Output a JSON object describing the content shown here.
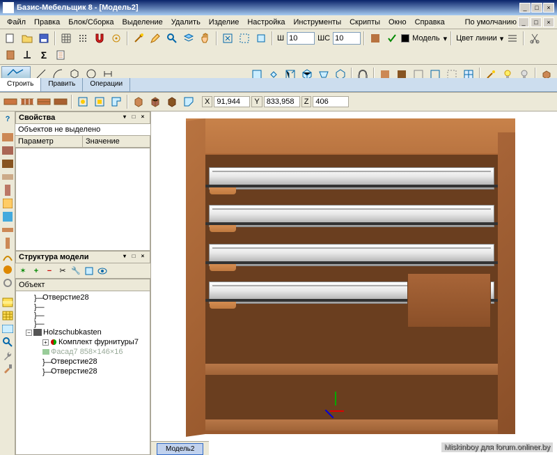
{
  "title": "Базис-Мебельщик 8 - [Модель2]",
  "menu": {
    "file": "Файл",
    "edit": "Правка",
    "block": "Блок/Сборка",
    "select": "Выделение",
    "delete": "Удалить",
    "product": "Изделие",
    "settings": "Настройка",
    "tools": "Инструменты",
    "scripts": "Скрипты",
    "window": "Окно",
    "help": "Справка",
    "default": "По умолчанию"
  },
  "topbar": {
    "w": "Ш",
    "wval": "10",
    "wc": "ШС",
    "wcval": "10",
    "model": "Модель",
    "linecolor": "Цвет линии"
  },
  "buildtabs": {
    "build": "Строить",
    "edit": "Править",
    "ops": "Операции"
  },
  "coords": {
    "x": "X",
    "xval": "91,944",
    "y": "Y",
    "yval": "833,958",
    "z": "Z",
    "zval": "406"
  },
  "panels": {
    "props_title": "Свойства",
    "props_status": "Объектов не выделено",
    "props_col1": "Параметр",
    "props_col2": "Значение",
    "struct_title": "Структура модели",
    "tree_head": "Объект"
  },
  "tree": {
    "i1": "Отверстие28",
    "i2_brace": "}—",
    "holz": "Holzschubkasten",
    "kit": "Комплект фурнитуры7",
    "facade": "Фасад7  858×146×16",
    "hole_a": "Отверстие28",
    "hole_b": "Отверстие28"
  },
  "doctab": "Модель2",
  "watermark": "Miskinboy для forum.onliner.by"
}
